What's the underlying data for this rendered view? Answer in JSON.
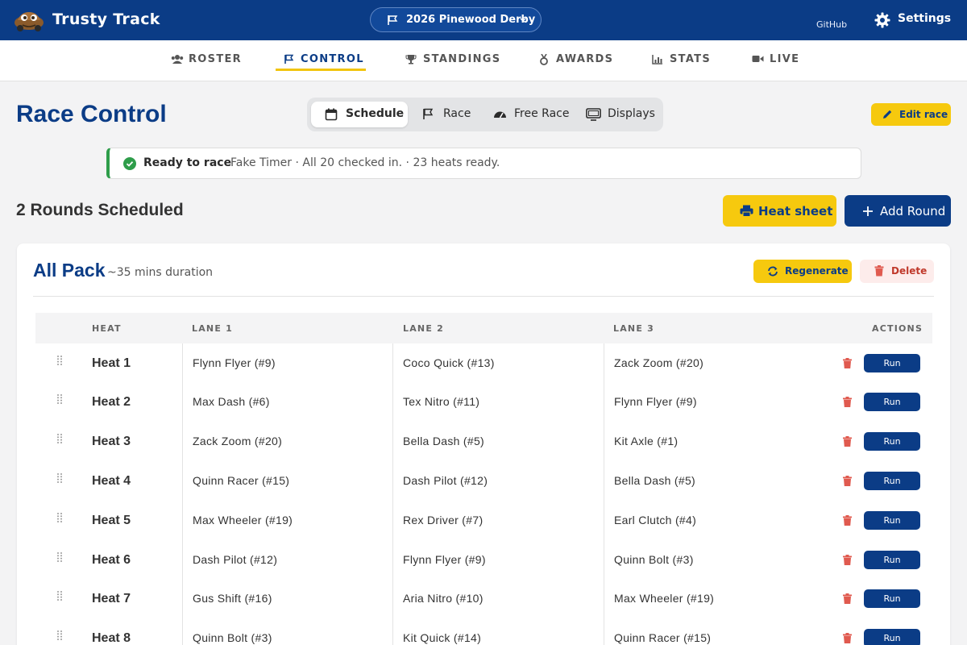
{
  "app": {
    "name": "Trusty Track",
    "event": "2026 Pinewood Derby",
    "github_label": "GitHub",
    "settings_label": "Settings",
    "icons": {
      "logo": "car-logo",
      "event": "flag-icon",
      "settings": "gear-icon"
    }
  },
  "nav": {
    "items": [
      {
        "label": "ROSTER",
        "icon": "users-icon"
      },
      {
        "label": "CONTROL",
        "icon": "flag-icon",
        "active": true
      },
      {
        "label": "STANDINGS",
        "icon": "trophy-icon"
      },
      {
        "label": "AWARDS",
        "icon": "medal-icon"
      },
      {
        "label": "STATS",
        "icon": "bar-chart-icon"
      },
      {
        "label": "LIVE",
        "icon": "video-icon"
      }
    ]
  },
  "page": {
    "title": "Race Control",
    "tabs": [
      {
        "label": "Schedule",
        "active": true
      },
      {
        "label": "Race"
      },
      {
        "label": "Free Race"
      },
      {
        "label": "Displays"
      }
    ],
    "edit_race": "Edit race"
  },
  "status": {
    "title": "Ready to race",
    "detail": "Fake Timer · All 20 checked in. · 23 heats ready."
  },
  "rounds": {
    "title": "2 Rounds Scheduled",
    "heat_sheet": "Heat sheet",
    "add_round": "Add Round"
  },
  "round": {
    "name": "All Pack",
    "duration": "~35 mins duration",
    "regenerate": "Regenerate",
    "delete": "Delete",
    "columns": {
      "heat": "HEAT",
      "lane1": "LANE 1",
      "lane2": "LANE 2",
      "lane3": "LANE 3",
      "actions": "ACTIONS"
    },
    "run_label": "Run",
    "heats": [
      {
        "heat": "Heat 1",
        "lanes": [
          "Flynn Flyer (#9)",
          "Coco Quick (#13)",
          "Zack Zoom (#20)"
        ]
      },
      {
        "heat": "Heat 2",
        "lanes": [
          "Max Dash (#6)",
          "Tex Nitro (#11)",
          "Flynn Flyer (#9)"
        ]
      },
      {
        "heat": "Heat 3",
        "lanes": [
          "Zack Zoom (#20)",
          "Bella Dash (#5)",
          "Kit Axle (#1)"
        ]
      },
      {
        "heat": "Heat 4",
        "lanes": [
          "Quinn Racer (#15)",
          "Dash Pilot (#12)",
          "Bella Dash (#5)"
        ]
      },
      {
        "heat": "Heat 5",
        "lanes": [
          "Max Wheeler (#19)",
          "Rex Driver (#7)",
          "Earl Clutch (#4)"
        ]
      },
      {
        "heat": "Heat 6",
        "lanes": [
          "Dash Pilot (#12)",
          "Flynn Flyer (#9)",
          "Quinn Bolt (#3)"
        ]
      },
      {
        "heat": "Heat 7",
        "lanes": [
          "Gus Shift (#16)",
          "Aria Nitro (#10)",
          "Max Wheeler (#19)"
        ]
      },
      {
        "heat": "Heat 8",
        "lanes": [
          "Quinn Bolt (#3)",
          "Kit Quick (#14)",
          "Quinn Racer (#15)"
        ]
      }
    ]
  },
  "colors": {
    "primary": "#0b3c86",
    "accent": "#f6c90e",
    "success": "#2e9d4a",
    "danger": "#e05a4f"
  }
}
